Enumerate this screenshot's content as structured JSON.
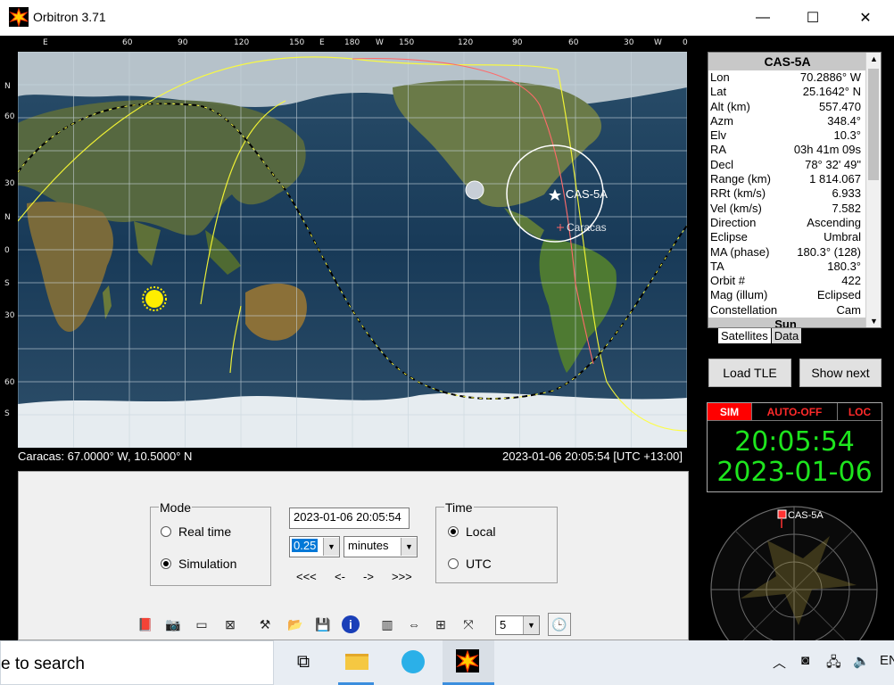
{
  "window": {
    "title": "Orbitron 3.71",
    "minimize": "—",
    "maximize": "☐",
    "close": "✕"
  },
  "map": {
    "top_scale": [
      "E",
      "60",
      "90",
      "120",
      "150",
      "E",
      "180",
      "W",
      "150",
      "120",
      "90",
      "60",
      "30",
      "W",
      "0"
    ],
    "left_scale": [
      "N",
      "60",
      "30",
      "N",
      "0",
      "S",
      "30",
      "60",
      "S"
    ],
    "satellite_label": "CAS-5A",
    "city_label": "Caracas",
    "status_left": "Caracas: 67.0000° W, 10.5000° N",
    "status_right": "2023-01-06 20:05:54 [UTC +13:00]"
  },
  "control": {
    "mode": {
      "label": "Mode",
      "options": [
        "Real time",
        "Simulation"
      ],
      "selected": "Simulation"
    },
    "datetime": "2023-01-06 20:05:54",
    "step_value": "0.25",
    "step_unit": "minutes",
    "step_buttons": [
      "<<<",
      "<-",
      "->",
      ">>>"
    ],
    "time": {
      "label": "Time",
      "options": [
        "Local",
        "UTC"
      ],
      "selected": "Local"
    },
    "speed_value": "5"
  },
  "satellite": {
    "name": "CAS-5A",
    "rows": [
      {
        "k": "Lon",
        "v": "70.2886° W"
      },
      {
        "k": "Lat",
        "v": "25.1642° N"
      },
      {
        "k": "Alt (km)",
        "v": "557.470"
      },
      {
        "k": "Azm",
        "v": "348.4°"
      },
      {
        "k": "Elv",
        "v": "10.3°"
      },
      {
        "k": "RA",
        "v": "03h 41m 09s"
      },
      {
        "k": "Decl",
        "v": "78° 32' 49\""
      },
      {
        "k": "Range (km)",
        "v": "1 814.067"
      },
      {
        "k": "RRt (km/s)",
        "v": "6.933"
      },
      {
        "k": "Vel (km/s)",
        "v": "7.582"
      },
      {
        "k": "Direction",
        "v": "Ascending"
      },
      {
        "k": "Eclipse",
        "v": "Umbral"
      },
      {
        "k": "MA (phase)",
        "v": "180.3° (128)"
      },
      {
        "k": "TA",
        "v": "180.3°"
      },
      {
        "k": "Orbit #",
        "v": "422"
      },
      {
        "k": "Mag (illum)",
        "v": "Eclipsed"
      },
      {
        "k": "Constellation",
        "v": "Cam"
      }
    ],
    "next_section": "Sun",
    "tabs": [
      "Satellites",
      "Data"
    ]
  },
  "buttons": {
    "load_tle": "Load TLE",
    "show_next": "Show next"
  },
  "clock": {
    "flags": [
      "SIM",
      "AUTO-OFF",
      "LOC"
    ],
    "time": "20:05:54",
    "date": "2023-01-06"
  },
  "radar": {
    "label": "CAS-5A"
  },
  "taskbar": {
    "search": "e to search",
    "lang": "EN"
  },
  "colors": {
    "accent_green": "#1ee51e",
    "flag_red": "#ff0000",
    "ground_track": "#ffff00"
  }
}
